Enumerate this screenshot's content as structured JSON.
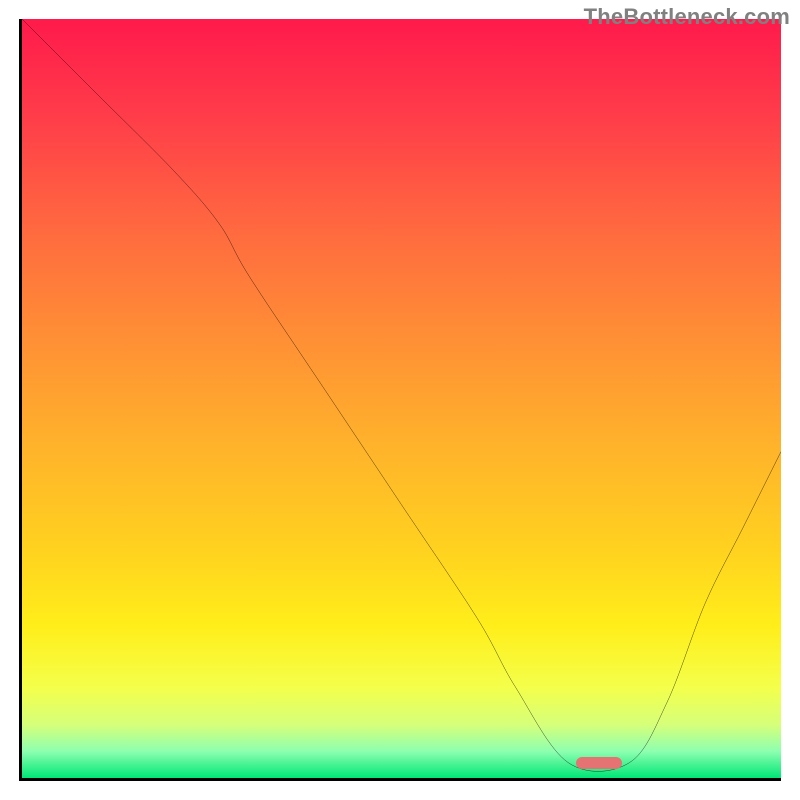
{
  "watermark": "TheBottleneck.com",
  "chart_data": {
    "type": "line",
    "title": "",
    "xlabel": "",
    "ylabel": "",
    "xlim": [
      0,
      100
    ],
    "ylim": [
      0,
      100
    ],
    "grid": false,
    "series": [
      {
        "name": "bottleneck-curve",
        "color": "#000000",
        "x": [
          0,
          10,
          20,
          26,
          30,
          40,
          50,
          60,
          65,
          72,
          80,
          85,
          90,
          95,
          100
        ],
        "values": [
          100,
          90,
          80,
          73,
          66,
          51,
          36,
          21,
          12,
          2,
          2,
          10,
          23,
          33,
          43
        ]
      }
    ],
    "marker": {
      "x": 76,
      "y": 2,
      "color": "#e57373"
    },
    "gradient_stops": [
      {
        "offset": 0.0,
        "color": "#ff1a4b"
      },
      {
        "offset": 0.12,
        "color": "#ff3a4a"
      },
      {
        "offset": 0.28,
        "color": "#ff6a3f"
      },
      {
        "offset": 0.42,
        "color": "#ff8f35"
      },
      {
        "offset": 0.56,
        "color": "#ffb22b"
      },
      {
        "offset": 0.7,
        "color": "#ffd21f"
      },
      {
        "offset": 0.8,
        "color": "#ffee1a"
      },
      {
        "offset": 0.88,
        "color": "#f4ff4a"
      },
      {
        "offset": 0.93,
        "color": "#d6ff7a"
      },
      {
        "offset": 0.965,
        "color": "#8dffb0"
      },
      {
        "offset": 1.0,
        "color": "#00e676"
      }
    ]
  }
}
